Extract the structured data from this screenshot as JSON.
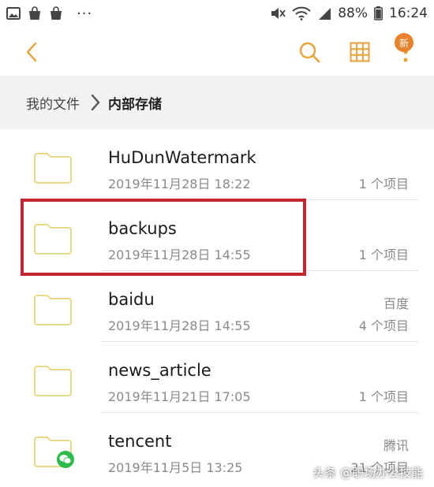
{
  "status_bar": {
    "battery": "88%",
    "time": "16:24",
    "more": "···"
  },
  "toolbar": {
    "new_badge": "新"
  },
  "breadcrumb": {
    "root": "我的文件",
    "current": "内部存储"
  },
  "files": [
    {
      "name": "HuDunWatermark",
      "date": "2019年11月28日 18:22",
      "tag": "",
      "count": "1 个项目",
      "icon": "folder-icon"
    },
    {
      "name": "backups",
      "date": "2019年11月28日 14:55",
      "tag": "",
      "count": "1 个项目",
      "icon": "folder-icon"
    },
    {
      "name": "baidu",
      "date": "2019年11月28日 14:55",
      "tag": "百度",
      "count": "4 个项目",
      "icon": "folder-icon"
    },
    {
      "name": "news_article",
      "date": "2019年11月21日 17:05",
      "tag": "",
      "count": "1 个项目",
      "icon": "folder-icon"
    },
    {
      "name": "tencent",
      "date": "2019年11月5日 13:25",
      "tag": "腾讯",
      "count": "21 个项目",
      "icon": "folder-icon"
    }
  ],
  "watermark": "头条 @职场办公技能",
  "colors": {
    "accent": "#e8a23a",
    "folder": "#e8d88a",
    "highlight": "#c42630",
    "badge": "#e8822a"
  }
}
